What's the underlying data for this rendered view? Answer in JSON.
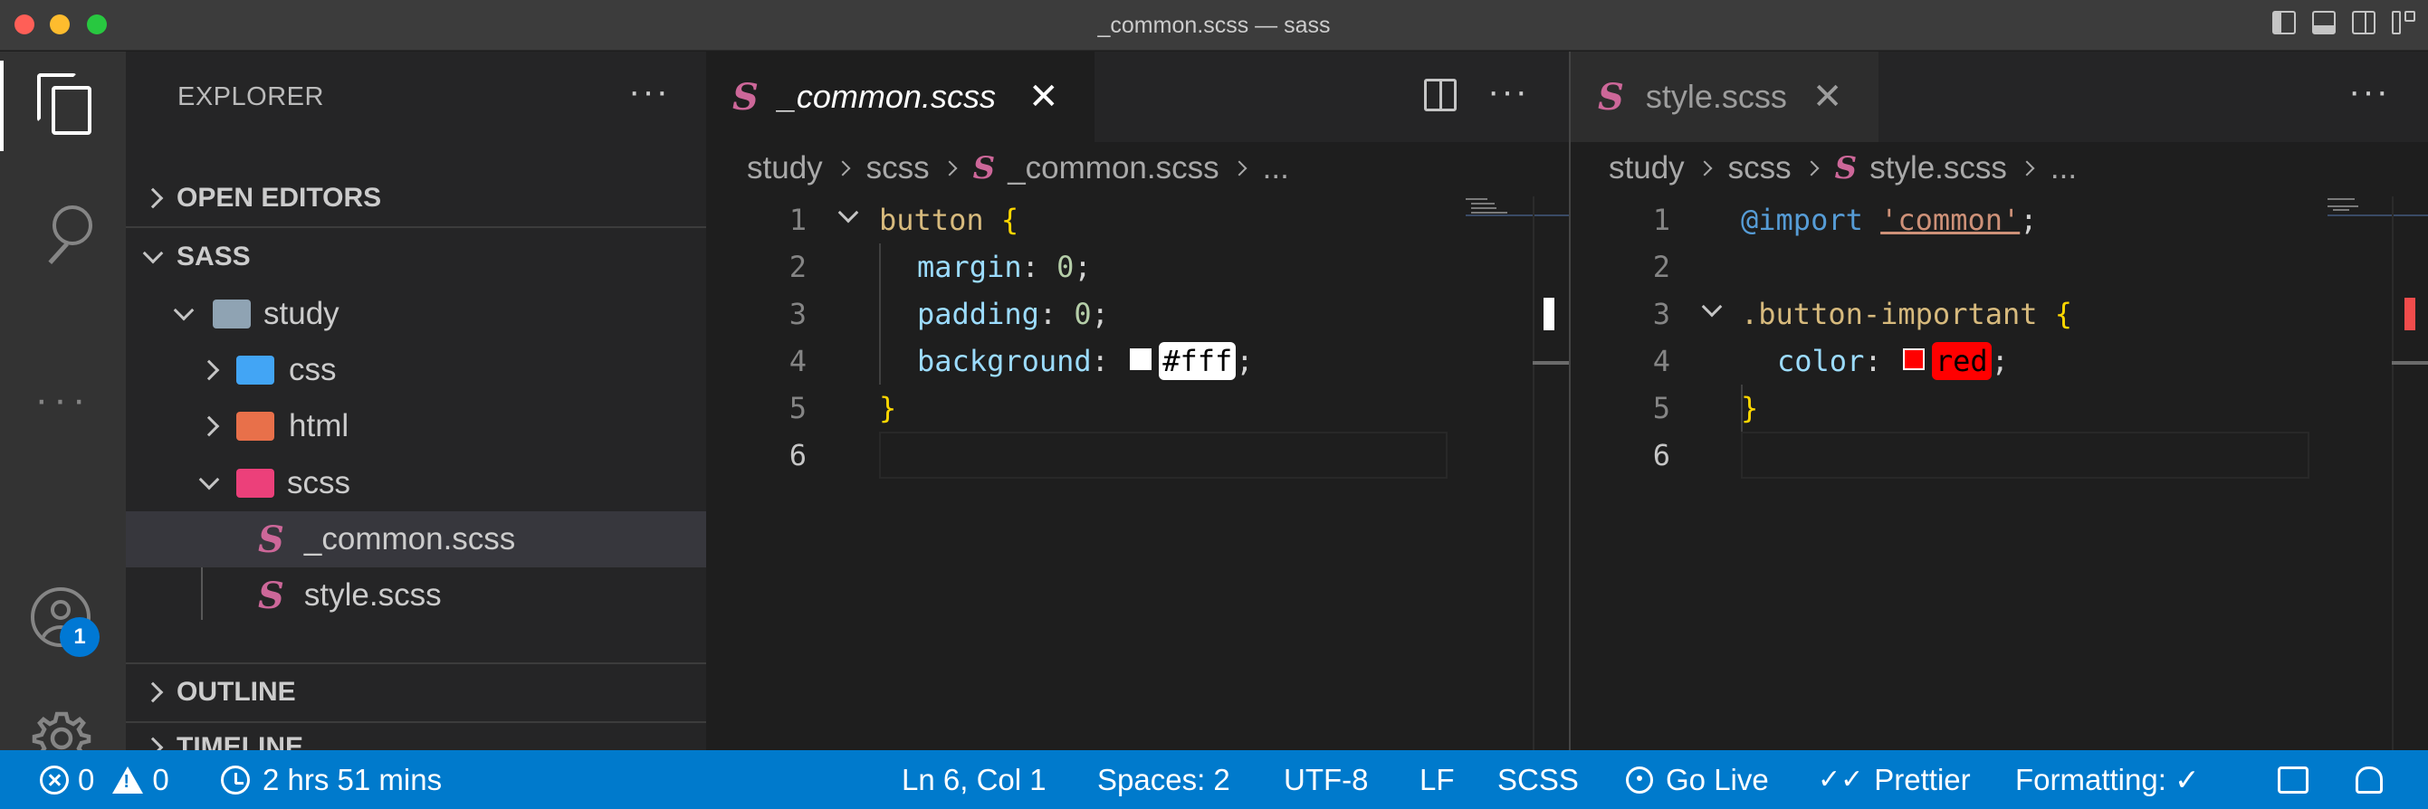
{
  "window": {
    "title": "_common.scss — sass"
  },
  "activity_bar": {
    "icons": [
      "files-icon",
      "search-icon",
      "more-icon",
      "account-icon",
      "gear-icon"
    ],
    "account_badge": "1"
  },
  "sidebar": {
    "header": "EXPLORER",
    "sections": {
      "open_editors": "OPEN EDITORS",
      "workspace": "SASS",
      "outline": "OUTLINE",
      "timeline": "TIMELINE"
    },
    "tree": {
      "study": "study",
      "css": "css",
      "html": "html",
      "scss": "scss",
      "common_file": "_common.scss",
      "style_file": "style.scss"
    }
  },
  "editor_left": {
    "tab_label": "_common.scss",
    "breadcrumb": [
      "study",
      "scss",
      "_common.scss",
      "..."
    ],
    "lines": {
      "n1": "1",
      "n2": "2",
      "n3": "3",
      "n4": "4",
      "n5": "5",
      "n6": "6",
      "l1_sel": "button",
      "l1_brace": "{",
      "l2_prop": "margin",
      "l2_val": "0",
      "l3_prop": "padding",
      "l3_val": "0",
      "l4_prop": "background",
      "l4_val": "#fff",
      "l5_brace": "}"
    }
  },
  "editor_right": {
    "tab_label": "style.scss",
    "breadcrumb": [
      "study",
      "scss",
      "style.scss",
      "..."
    ],
    "lines": {
      "n1": "1",
      "n2": "2",
      "n3": "3",
      "n4": "4",
      "n5": "5",
      "n6": "6",
      "l1_kw": "@import",
      "l1_str": "'common'",
      "l3_sel": ".button-important",
      "l3_brace": "{",
      "l4_prop": "color",
      "l4_val": "red",
      "l5_brace": "}"
    }
  },
  "status_bar": {
    "errors": "0",
    "warnings": "0",
    "time": "2 hrs 51 mins",
    "position": "Ln 6, Col 1",
    "spaces": "Spaces: 2",
    "encoding": "UTF-8",
    "eol": "LF",
    "language": "SCSS",
    "go_live": "Go Live",
    "prettier": "Prettier",
    "formatting": "Formatting: ✓"
  },
  "colors": {
    "status_bar": "#007acc",
    "sass_pink": "#cd6799",
    "swatch_white": "#ffffff",
    "swatch_red": "#ff0000"
  }
}
